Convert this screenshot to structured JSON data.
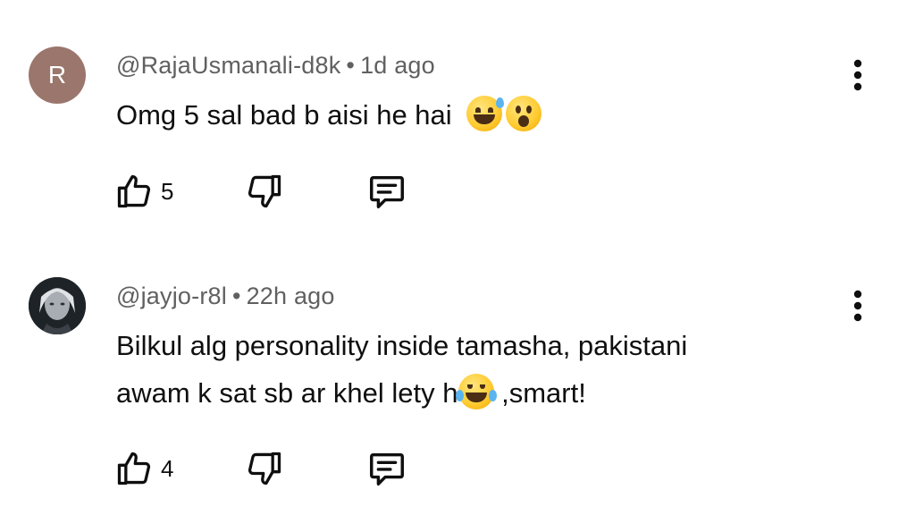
{
  "comments": [
    {
      "avatar_letter": "R",
      "author": "@RajaUsmanali-d8k",
      "separator": "•",
      "time": "1d ago",
      "text": "Omg 5 sal bad b aisi he hai",
      "emojis": [
        "grinning-sweat-emoji",
        "astonished-emoji"
      ],
      "likes": "5"
    },
    {
      "avatar_letter": "",
      "author": "@jayjo-r8l",
      "separator": "•",
      "time": "22h ago",
      "text_line1": "Bilkul alg personality inside tamasha, pakistani",
      "text_line2_before": "awam k sat sb ar khel lety h",
      "text_line2_after": " ,smart!",
      "emojis": [
        "tears-of-joy-emoji"
      ],
      "likes": "4"
    }
  ],
  "icons": {
    "like": "thumbs-up-icon",
    "dislike": "thumbs-down-icon",
    "reply": "reply-comment-icon",
    "menu": "more-vertical-icon"
  },
  "colors": {
    "avatar_r": "#9a766c",
    "meta_text": "#606060",
    "body_text": "#0f0f0f"
  }
}
